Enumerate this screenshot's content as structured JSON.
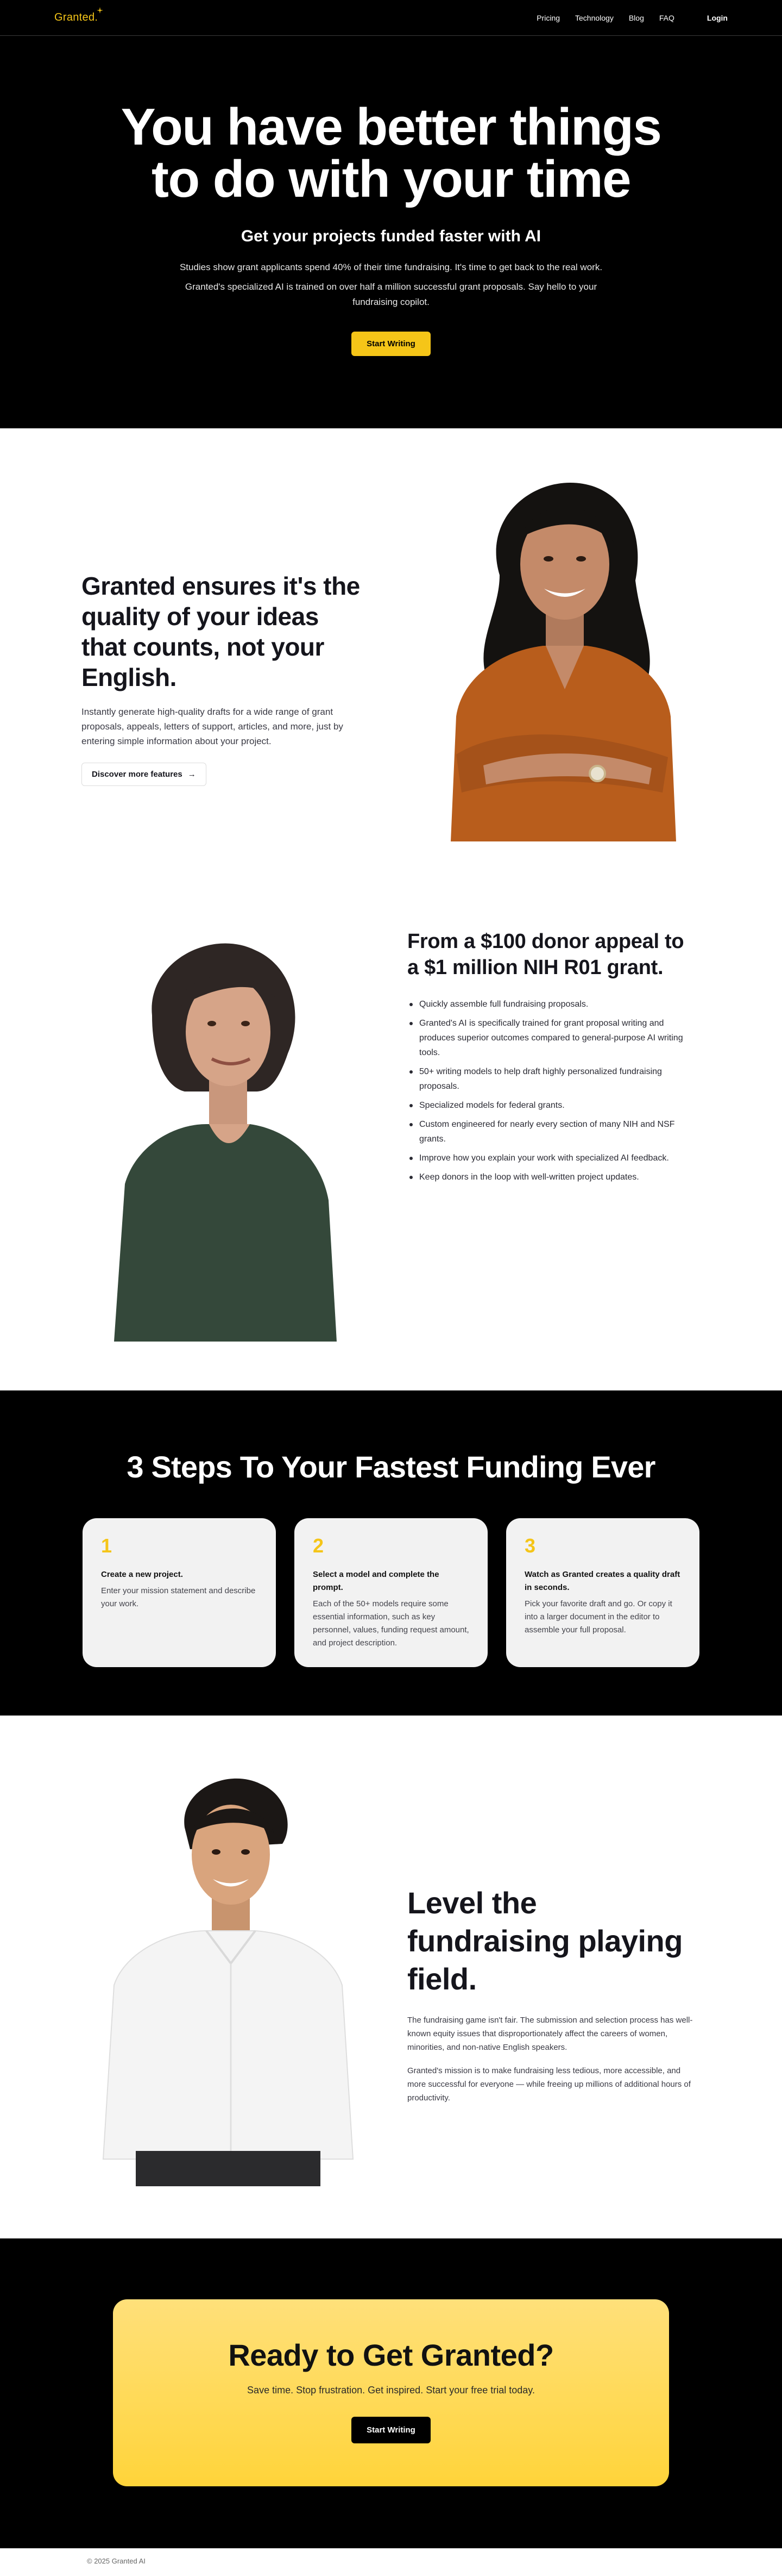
{
  "nav": {
    "logo": "Granted",
    "links": [
      "Pricing",
      "Technology",
      "Blog",
      "FAQ"
    ],
    "login": "Login"
  },
  "hero": {
    "title": "You have better things to do with your time",
    "subtitle": "Get your projects funded faster with AI",
    "p1": "Studies show grant applicants spend 40% of their time fundraising. It's time to get back to the real work.",
    "p2": "Granted's specialized AI is trained on over half a million successful grant proposals. Say hello to your fundraising copilot.",
    "cta": "Start Writing"
  },
  "feature1": {
    "title": "Granted ensures it's the quality of your ideas that counts, not your English.",
    "body": "Instantly generate high-quality drafts for a wide range of grant proposals, appeals, letters of support, articles, and more, just by entering simple information about your project.",
    "button": "Discover more features",
    "arrow": "→"
  },
  "feature2": {
    "title": "From a $100 donor appeal to a $1 million NIH R01 grant.",
    "bullets": [
      "Quickly assemble full fundraising proposals.",
      "Granted's AI is specifically trained for grant proposal writing and produces superior outcomes compared to general-purpose AI writing tools.",
      "50+ writing models to help draft highly personalized fundraising proposals.",
      "Specialized models for federal grants.",
      "Custom engineered for nearly every section of many NIH and NSF grants.",
      "Improve how you explain your work with specialized AI feedback.",
      "Keep donors in the loop with well-written project updates."
    ]
  },
  "steps": {
    "title": "3 Steps To Your Fastest Funding Ever",
    "cards": [
      {
        "num": "1",
        "title": "Create a new project.",
        "desc": "Enter your mission statement and describe your work."
      },
      {
        "num": "2",
        "title": "Select a model and complete the prompt.",
        "desc": "Each of the 50+ models require some essential information, such as key personnel, values, funding request amount, and project description."
      },
      {
        "num": "3",
        "title": "Watch as Granted creates a quality draft in seconds.",
        "desc": "Pick your favorite draft and go. Or copy it into a larger document in the editor to assemble your full proposal."
      }
    ]
  },
  "feature3": {
    "title": "Level the fundraising playing field.",
    "p1": "The fundraising game isn't fair. The submission and selection process has well-known equity issues that disproportionately affect the careers of women, minorities, and non-native English speakers.",
    "p2": "Granted's mission is to make fundraising less tedious, more accessible, and more successful for everyone — while freeing up millions of additional hours of productivity."
  },
  "cta": {
    "title": "Ready to Get Granted?",
    "subtitle": "Save time. Stop frustration. Get inspired. Start your free trial today.",
    "button": "Start Writing"
  },
  "footer": {
    "copyright": "© 2025 Granted AI"
  },
  "colors": {
    "accent": "#f5c518",
    "dark": "#000000",
    "card": "#f2f2f2"
  }
}
